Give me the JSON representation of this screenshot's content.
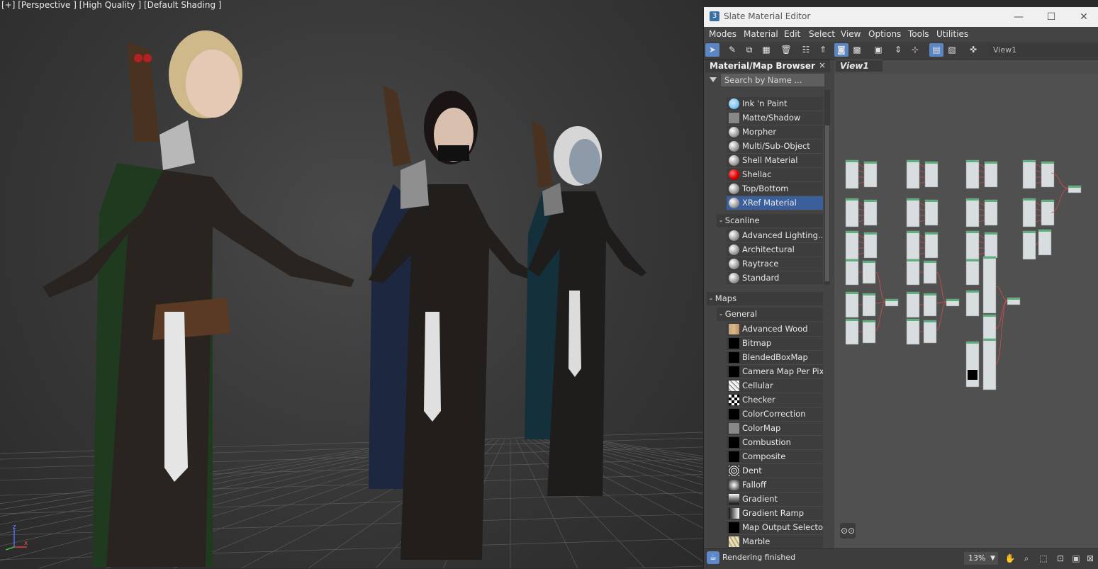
{
  "viewport": {
    "label": "[+] [Perspective ] [High Quality ] [Default Shading ]",
    "axis_labels": {
      "z": "z",
      "x": "x"
    }
  },
  "window": {
    "title": "Slate Material Editor",
    "icon": "3",
    "minimize": "—",
    "maximize": "☐",
    "close": "✕"
  },
  "menu": [
    "Modes",
    "Material",
    "Edit",
    "Select",
    "View",
    "Options",
    "Tools",
    "Utilities"
  ],
  "toolbar": {
    "view_name": "View1"
  },
  "browser": {
    "title": "Material/Map Browser",
    "close": "×",
    "search_placeholder": "Search by Name ...",
    "items": [
      {
        "label": "Ink 'n Paint",
        "swatch": "ink"
      },
      {
        "label": "Matte/Shadow",
        "swatch": "gray"
      },
      {
        "label": "Morpher",
        "swatch": "sphere"
      },
      {
        "label": "Multi/Sub-Object",
        "swatch": "sphere"
      },
      {
        "label": "Shell Material",
        "swatch": "sphere"
      },
      {
        "label": "Shellac",
        "swatch": "red"
      },
      {
        "label": "Top/Bottom",
        "swatch": "sphere"
      },
      {
        "label": "XRef Material",
        "swatch": "sphere",
        "selected": true
      }
    ],
    "scanline_group": "- Scanline",
    "scanline_items": [
      {
        "label": "Advanced Lighting...",
        "swatch": "sphere"
      },
      {
        "label": "Architectural",
        "swatch": "sphere"
      },
      {
        "label": "Raytrace",
        "swatch": "sphere"
      },
      {
        "label": "Standard",
        "swatch": "sphere"
      }
    ],
    "maps_group": "- Maps",
    "general_group": "- General",
    "map_items": [
      {
        "label": "Advanced Wood",
        "swatch": "wood"
      },
      {
        "label": "Bitmap",
        "swatch": "black"
      },
      {
        "label": "BlendedBoxMap",
        "swatch": "black"
      },
      {
        "label": "Camera Map Per Pixel",
        "swatch": "black"
      },
      {
        "label": "Cellular",
        "swatch": "noise"
      },
      {
        "label": "Checker",
        "swatch": "checker"
      },
      {
        "label": "ColorCorrection",
        "swatch": "black"
      },
      {
        "label": "ColorMap",
        "swatch": "gray"
      },
      {
        "label": "Combustion",
        "swatch": "black"
      },
      {
        "label": "Composite",
        "swatch": "black"
      },
      {
        "label": "Dent",
        "swatch": "dent"
      },
      {
        "label": "Falloff",
        "swatch": "falloff"
      },
      {
        "label": "Gradient",
        "swatch": "gradient"
      },
      {
        "label": "Gradient Ramp",
        "swatch": "ramp"
      },
      {
        "label": "Map Output Selector",
        "swatch": "black"
      },
      {
        "label": "Marble",
        "swatch": "marble"
      }
    ]
  },
  "view": {
    "tab_label": "View1"
  },
  "status": {
    "text": "Rendering finished",
    "zoom": "13%"
  },
  "colors": {
    "accent": "#5b86c4",
    "selected": "#3a5f9a",
    "node_green": "#5fae7e",
    "wire_red": "#d64b4b"
  }
}
